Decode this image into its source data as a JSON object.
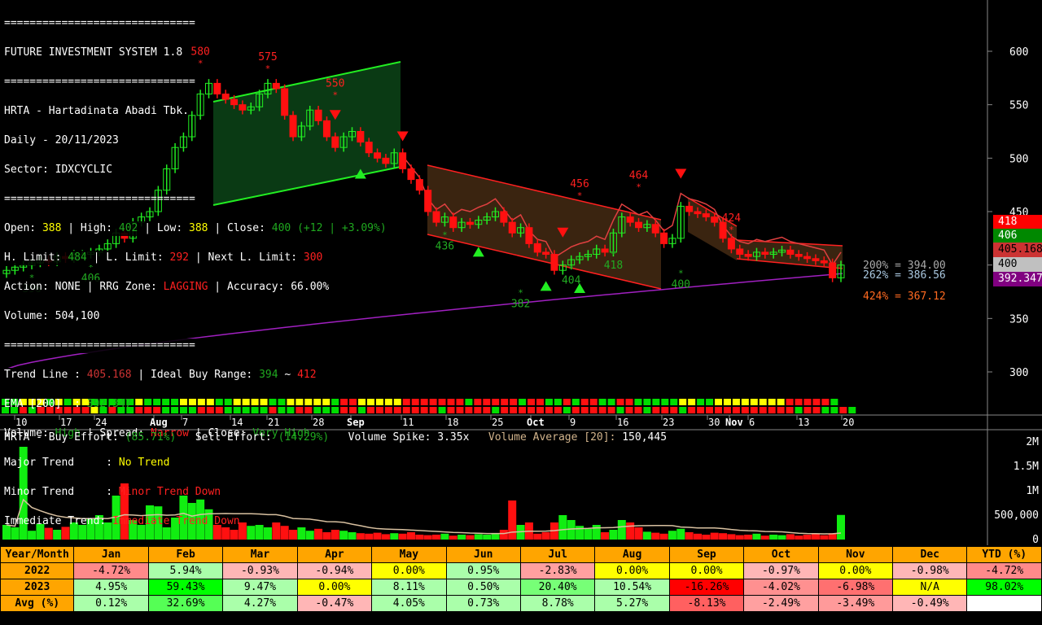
{
  "header": {
    "sep": "==============================",
    "title": "FUTURE INVESTMENT SYSTEM 1.8",
    "stock": "HRTA - Hartadinata Abadi Tbk.",
    "period": "Daily - 20/11/2023",
    "sector": "Sector: IDXCYCLIC"
  },
  "ohlc": {
    "open_l": "Open: ",
    "open": "388",
    "high_l": " | High: ",
    "high": "402",
    "low_l": " | Low: ",
    "low": "388",
    "close_l": " | Close: ",
    "close": "400 (+12 | +3.09%)"
  },
  "limits": {
    "h_l": "H. Limit: ",
    "h": "484",
    "l_l": " | L. Limit: ",
    "l": "292",
    "n_l": " | Next L. Limit: ",
    "n": "300"
  },
  "action": {
    "a_l": "Action: NONE | RRG Zone: ",
    "rrg": "LAGGING",
    "acc": " | Accuracy: 66.00%"
  },
  "volume_line": "Volume: 504,100",
  "trend": {
    "tl_l": "Trend Line : ",
    "tl": "405.168",
    "ib_l": " | Ideal Buy Range: ",
    "ib_lo": "394",
    "ib_sep": " ~ ",
    "ib_hi": "412",
    "ema_l": "EMA [200]  : ",
    "ema": "392.347"
  },
  "vsc": {
    "v_l": "Volume: ",
    "v": "High",
    "s_l": " | Spread: ",
    "s": "Narrow",
    "c_l": " | Close: ",
    "c": "Very High"
  },
  "trends": {
    "major_l": "Major Trend     : ",
    "major": "No Trend",
    "minor_l": "Minor Trend     : ",
    "minor": "Minor Trend Down",
    "imm_l": "Immediate Trend: ",
    "imm": "Immediate Trend Down"
  },
  "volume_panel": {
    "buy_l": "HRTA - Buy Effort: ",
    "buy": "(85.71%)",
    "sell_l": "   Sell Effort: ",
    "sell": "(14.29%)",
    "spike": "   Volume Spike: 3.35x",
    "avg_l": "   Volume Average [20]: ",
    "avg": "150,445"
  },
  "price_tags": [
    {
      "v": "418",
      "bg": "#ff0000",
      "fg": "#fff"
    },
    {
      "v": "406",
      "bg": "#008800",
      "fg": "#fff"
    },
    {
      "v": "405.168",
      "bg": "#cc3333",
      "fg": "#000"
    },
    {
      "v": "400",
      "bg": "#c0c0c0",
      "fg": "#000"
    },
    {
      "v": "392.347",
      "bg": "#800080",
      "fg": "#fff"
    }
  ],
  "fib": [
    {
      "t": "200% = 394.00",
      "c": "#aaaaaa"
    },
    {
      "t": "262% = 386.56",
      "c": "#aac8e0"
    },
    {
      "t": "424% = 367.12",
      "c": "#ff6a20"
    }
  ],
  "chart_data": {
    "type": "candlestick",
    "yaxis": {
      "ticks": [
        300,
        350,
        400,
        450,
        500,
        550,
        600
      ],
      "ylim": [
        300,
        600
      ]
    },
    "vol_axis": {
      "ticks": [
        "0",
        "500,000",
        "1M",
        "1.5M",
        "2M"
      ],
      "values": [
        0,
        500000,
        1000000,
        1500000,
        2000000
      ]
    },
    "xticks": [
      {
        "t": "10",
        "b": 0
      },
      {
        "t": "17",
        "b": 0
      },
      {
        "t": "24",
        "b": 0
      },
      {
        "t": "Aug",
        "b": 1
      },
      {
        "t": "7",
        "b": 0
      },
      {
        "t": "14",
        "b": 0
      },
      {
        "t": "21",
        "b": 0
      },
      {
        "t": "28",
        "b": 0
      },
      {
        "t": "Sep",
        "b": 1
      },
      {
        "t": "11",
        "b": 0
      },
      {
        "t": "18",
        "b": 0
      },
      {
        "t": "25",
        "b": 0
      },
      {
        "t": "Oct",
        "b": 1
      },
      {
        "t": "9",
        "b": 0
      },
      {
        "t": "16",
        "b": 0
      },
      {
        "t": "23",
        "b": 0
      },
      {
        "t": "30",
        "b": 0
      },
      {
        "t": "Nov",
        "b": 1
      },
      {
        "t": "6",
        "b": 0
      },
      {
        "t": "13",
        "b": 0
      },
      {
        "t": "20",
        "b": 0
      }
    ],
    "closes": [
      395,
      398,
      400,
      402,
      405,
      403,
      408,
      406,
      410,
      410,
      412,
      415,
      420,
      430,
      425,
      440,
      445,
      450,
      470,
      490,
      510,
      520,
      540,
      560,
      570,
      560,
      555,
      550,
      545,
      548,
      560,
      570,
      565,
      540,
      520,
      530,
      545,
      535,
      520,
      510,
      520,
      525,
      515,
      505,
      500,
      495,
      505,
      490,
      480,
      470,
      450,
      440,
      445,
      435,
      440,
      438,
      442,
      445,
      450,
      440,
      430,
      435,
      420,
      412,
      410,
      395,
      400,
      405,
      408,
      410,
      415,
      412,
      430,
      445,
      440,
      435,
      438,
      430,
      420,
      425,
      455,
      450,
      448,
      445,
      440,
      425,
      415,
      410,
      408,
      412,
      410,
      412,
      414,
      410,
      408,
      406,
      404,
      402,
      388,
      400
    ],
    "volume_k": [
      300,
      250,
      1900,
      180,
      320,
      240,
      200,
      260,
      350,
      300,
      420,
      500,
      350,
      900,
      1150,
      400,
      300,
      700,
      680,
      250,
      450,
      900,
      750,
      820,
      620,
      300,
      250,
      200,
      350,
      280,
      300,
      250,
      350,
      280,
      200,
      250,
      180,
      220,
      150,
      200,
      180,
      150,
      130,
      120,
      140,
      110,
      130,
      120,
      150,
      100,
      90,
      100,
      120,
      80,
      100,
      90,
      110,
      100,
      120,
      200,
      800,
      300,
      350,
      120,
      150,
      350,
      500,
      400,
      280,
      220,
      300,
      150,
      200,
      400,
      350,
      250,
      160,
      140,
      120,
      180,
      220,
      150,
      120,
      100,
      140,
      130,
      110,
      90,
      100,
      120,
      80,
      100,
      90,
      110,
      80,
      100,
      120,
      90,
      130,
      504
    ],
    "heat_top": "GGYYYGYGYYGGGGGYGGGGYYYYGGYYYYGGYYYYYGRRYYYYYRRRRRRRGRRRRRGRRGGRGRRGGRRGGGGGYYGGYYYYYYYYRRRRRG",
    "heat_bot": "GGRGRRRRRRYGRGGRRRGGGGRRRGGGGGRGGRRGGGRRGRRRRRRRRGRRRRRGRRRRRRRGRRRRRGRRGRRRGRRRRRRRRRRRRGRRGGRG",
    "labels": [
      {
        "t": "580",
        "i": 23
      },
      {
        "t": "575",
        "i": 31
      },
      {
        "t": "550",
        "i": 39
      },
      {
        "t": "396",
        "i": 3
      },
      {
        "t": "406",
        "i": 10
      },
      {
        "t": "436",
        "i": 52
      },
      {
        "t": "382",
        "i": 61
      },
      {
        "t": "456",
        "i": 68
      },
      {
        "t": "404",
        "i": 67
      },
      {
        "t": "418",
        "i": 72
      },
      {
        "t": "464",
        "i": 75
      },
      {
        "t": "400",
        "i": 80
      },
      {
        "t": "424",
        "i": 86
      }
    ]
  },
  "table": {
    "header": [
      "Year/Month",
      "Jan",
      "Feb",
      "Mar",
      "Apr",
      "May",
      "Jun",
      "Jul",
      "Aug",
      "Sep",
      "Oct",
      "Nov",
      "Dec",
      "YTD (%)"
    ],
    "rows": [
      {
        "label": "2022",
        "cells": [
          [
            "-4.72%",
            "#ff8a8a"
          ],
          [
            "5.94%",
            "#aaffaa"
          ],
          [
            "-0.93%",
            "#ffb6b6"
          ],
          [
            "-0.94%",
            "#ffb6b6"
          ],
          [
            "0.00%",
            "#ffff00"
          ],
          [
            "0.95%",
            "#aaffaa"
          ],
          [
            "-2.83%",
            "#ffa0a0"
          ],
          [
            "0.00%",
            "#ffff00"
          ],
          [
            "0.00%",
            "#ffff00"
          ],
          [
            "-0.97%",
            "#ffb6b6"
          ],
          [
            "0.00%",
            "#ffff00"
          ],
          [
            "-0.98%",
            "#ffb6b6"
          ],
          [
            "-4.72%",
            "#ff8a8a"
          ]
        ]
      },
      {
        "label": "2023",
        "cells": [
          [
            "4.95%",
            "#aaffaa"
          ],
          [
            "59.43%",
            "#00ff00"
          ],
          [
            "9.47%",
            "#aaffaa"
          ],
          [
            "0.00%",
            "#ffff00"
          ],
          [
            "8.11%",
            "#aaffaa"
          ],
          [
            "0.50%",
            "#aaffaa"
          ],
          [
            "20.40%",
            "#77ff77"
          ],
          [
            "10.54%",
            "#aaffaa"
          ],
          [
            "-16.26%",
            "#ff0000"
          ],
          [
            "-4.02%",
            "#ff9090"
          ],
          [
            "-6.98%",
            "#ff7070"
          ],
          [
            "N/A",
            "#ffff00"
          ],
          [
            "98.02%",
            "#00ff00"
          ]
        ]
      },
      {
        "label": "Avg (%)",
        "cells": [
          [
            "0.12%",
            "#aaffaa"
          ],
          [
            "32.69%",
            "#55ff55"
          ],
          [
            "4.27%",
            "#aaffaa"
          ],
          [
            "-0.47%",
            "#ffb6b6"
          ],
          [
            "4.05%",
            "#aaffaa"
          ],
          [
            "0.73%",
            "#aaffaa"
          ],
          [
            "8.78%",
            "#aaffaa"
          ],
          [
            "5.27%",
            "#aaffaa"
          ],
          [
            "-8.13%",
            "#ff6060"
          ],
          [
            "-2.49%",
            "#ffa0a0"
          ],
          [
            "-3.49%",
            "#ff9a9a"
          ],
          [
            "-0.49%",
            "#ffb6b6"
          ],
          [
            "",
            "#ffffff"
          ]
        ]
      }
    ]
  }
}
